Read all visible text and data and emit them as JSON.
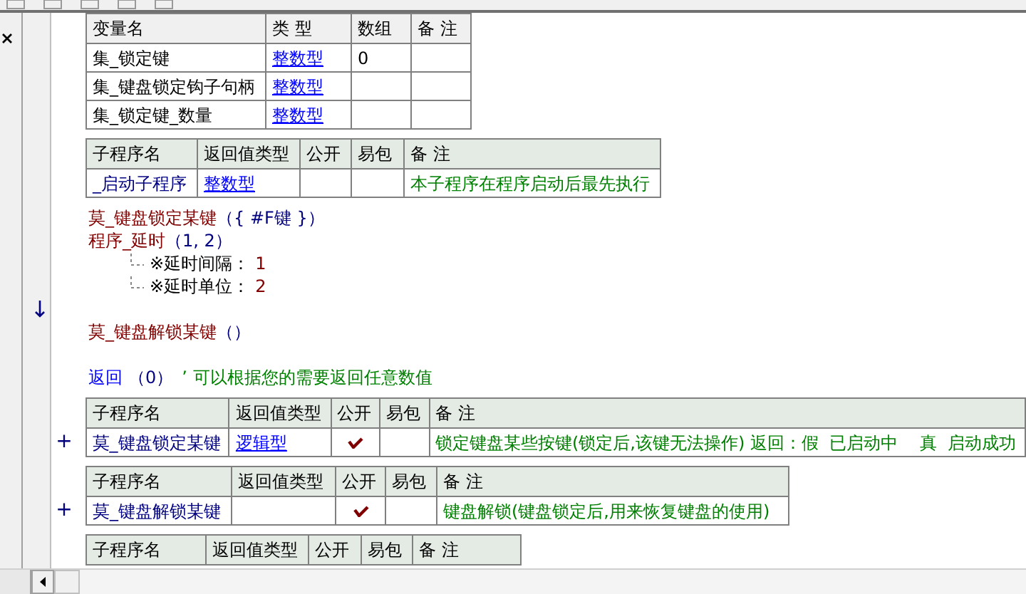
{
  "var_table": {
    "columns": [
      "变量名",
      "类 型",
      "数组",
      "备 注"
    ],
    "rows": [
      {
        "name": "集_锁定键",
        "type": "整数型",
        "array": "0"
      },
      {
        "name": "集_键盘锁定钩子句柄",
        "type": "整数型"
      },
      {
        "name": "集_锁定键_数量",
        "type": "整数型"
      }
    ]
  },
  "subroutines": [
    {
      "columns": [
        "子程序名",
        "返回值类型",
        "公开",
        "易包",
        "备 注"
      ],
      "name": "_启动子程序",
      "return_type": "整数型",
      "public": false,
      "note": "本子程序在程序启动后最先执行",
      "code": [
        {
          "kind": "call",
          "name": "莫_键盘锁定某键",
          "args": "（{ #F键 }）"
        },
        {
          "kind": "call",
          "name": "程序_延时",
          "args": "（1, 2）"
        },
        {
          "kind": "param",
          "label": "※延时间隔：",
          "value": "1"
        },
        {
          "kind": "param",
          "label": "※延时单位：",
          "value": "2"
        },
        {
          "kind": "blank",
          "current": true
        },
        {
          "kind": "call",
          "name": "莫_键盘解锁某键",
          "args": "（）"
        },
        {
          "kind": "blank"
        },
        {
          "kind": "return",
          "keyword": "返回",
          "args": "（0）",
          "comment": "’ 可以根据您的需要返回任意数值"
        }
      ]
    },
    {
      "columns": [
        "子程序名",
        "返回值类型",
        "公开",
        "易包",
        "备 注"
      ],
      "expander": "+",
      "name": "莫_键盘锁定某键",
      "return_type": "逻辑型",
      "public": true,
      "note": "锁定键盘某些按键(锁定后,该键无法操作) 返回：假  已启动中    真  启动成功"
    },
    {
      "columns": [
        "子程序名",
        "返回值类型",
        "公开",
        "易包",
        "备 注"
      ],
      "expander": "+",
      "name": "莫_键盘解锁某键",
      "public": true,
      "note": "键盘解锁(键盘锁定后,用来恢复键盘的使用)"
    },
    {
      "columns": [
        "子程序名",
        "返回值类型",
        "公开",
        "易包",
        "备 注"
      ]
    }
  ]
}
